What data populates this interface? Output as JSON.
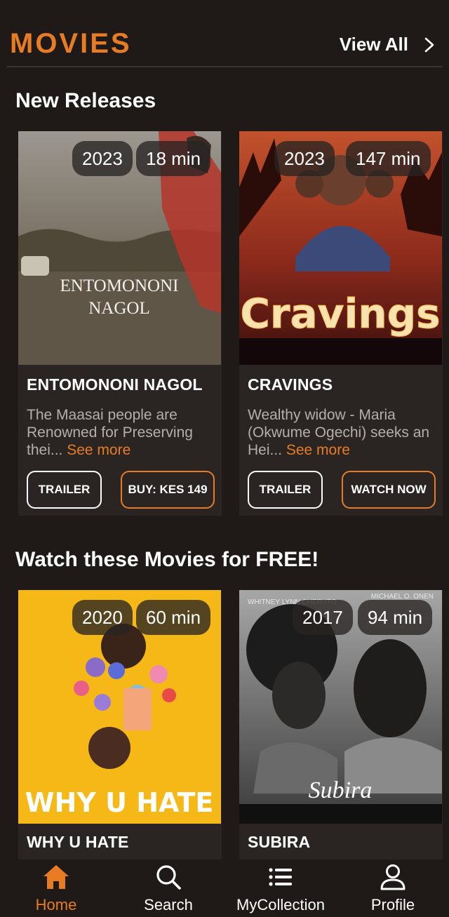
{
  "header": {
    "title": "MOVIES",
    "view_all": "View All"
  },
  "sections": {
    "new_releases": "New Releases",
    "free": "Watch these Movies for FREE!"
  },
  "movies": [
    {
      "year": "2023",
      "duration": "18 min",
      "poster_title_line1": "ENTOMONONI",
      "poster_title_line2": "NAGOL",
      "title": "ENTOMONONI NAGOL",
      "desc": "The Maasai people are Renowned for Preserving thei...",
      "see_more": "See more",
      "trailer": "TRAILER",
      "action": "BUY: KES 149"
    },
    {
      "year": "2023",
      "duration": "147 min",
      "poster_title": "Cravings",
      "title": "CRAVINGS",
      "desc": "Wealthy widow - Maria (Okwume Ogechi) seeks an Hei...",
      "see_more": "See more",
      "trailer": "TRAILER",
      "action": "WATCH NOW"
    },
    {
      "year": "2020",
      "duration": "60 min",
      "poster_title": "WHY U HATE",
      "title": "WHY U HATE"
    },
    {
      "year": "2017",
      "duration": "94 min",
      "poster_title": "Subira",
      "poster_credit_left": "WHITNEY LYNN CHERUTO",
      "poster_credit_right": "MICHAEL O. ONEN",
      "title": "SUBIRA"
    }
  ],
  "nav": [
    {
      "label": "Home",
      "icon": "home-icon"
    },
    {
      "label": "Search",
      "icon": "search-icon"
    },
    {
      "label": "MyCollection",
      "icon": "list-icon"
    },
    {
      "label": "Profile",
      "icon": "profile-icon"
    }
  ],
  "colors": {
    "accent": "#e87c25",
    "background": "#1f1a17",
    "card": "#2a2522"
  }
}
